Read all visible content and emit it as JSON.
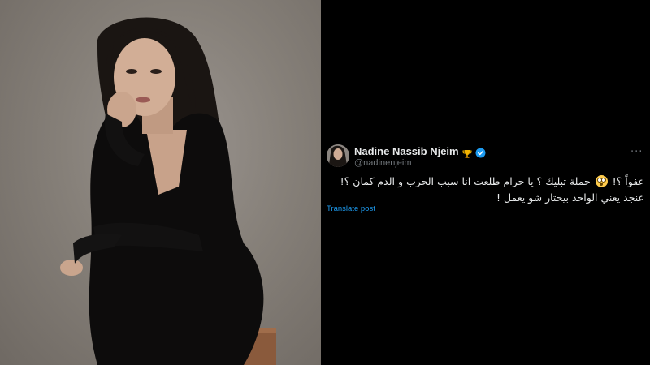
{
  "post": {
    "author_name": "Nadine Nassib Njeim",
    "author_handle": "@nadinenjeim",
    "badges": [
      "trophy-icon",
      "verified-badge-icon"
    ],
    "text_before_emoji": "عفواً ؟!",
    "emoji": "flushed-face-emoji",
    "text_after_emoji": "حملة تبليك ؟ يا حرام طلعت انا سبب الحرب و الدم كمان ؟! عنجد يعني الواحد بيحتار شو يعمل !",
    "translate_label": "Translate post",
    "more_icon": "more-options-icon"
  },
  "colors": {
    "background": "#000000",
    "text": "#e7e9ea",
    "secondary_text": "#71767b",
    "link": "#1d9bf0",
    "verified": "#1d9bf0"
  }
}
